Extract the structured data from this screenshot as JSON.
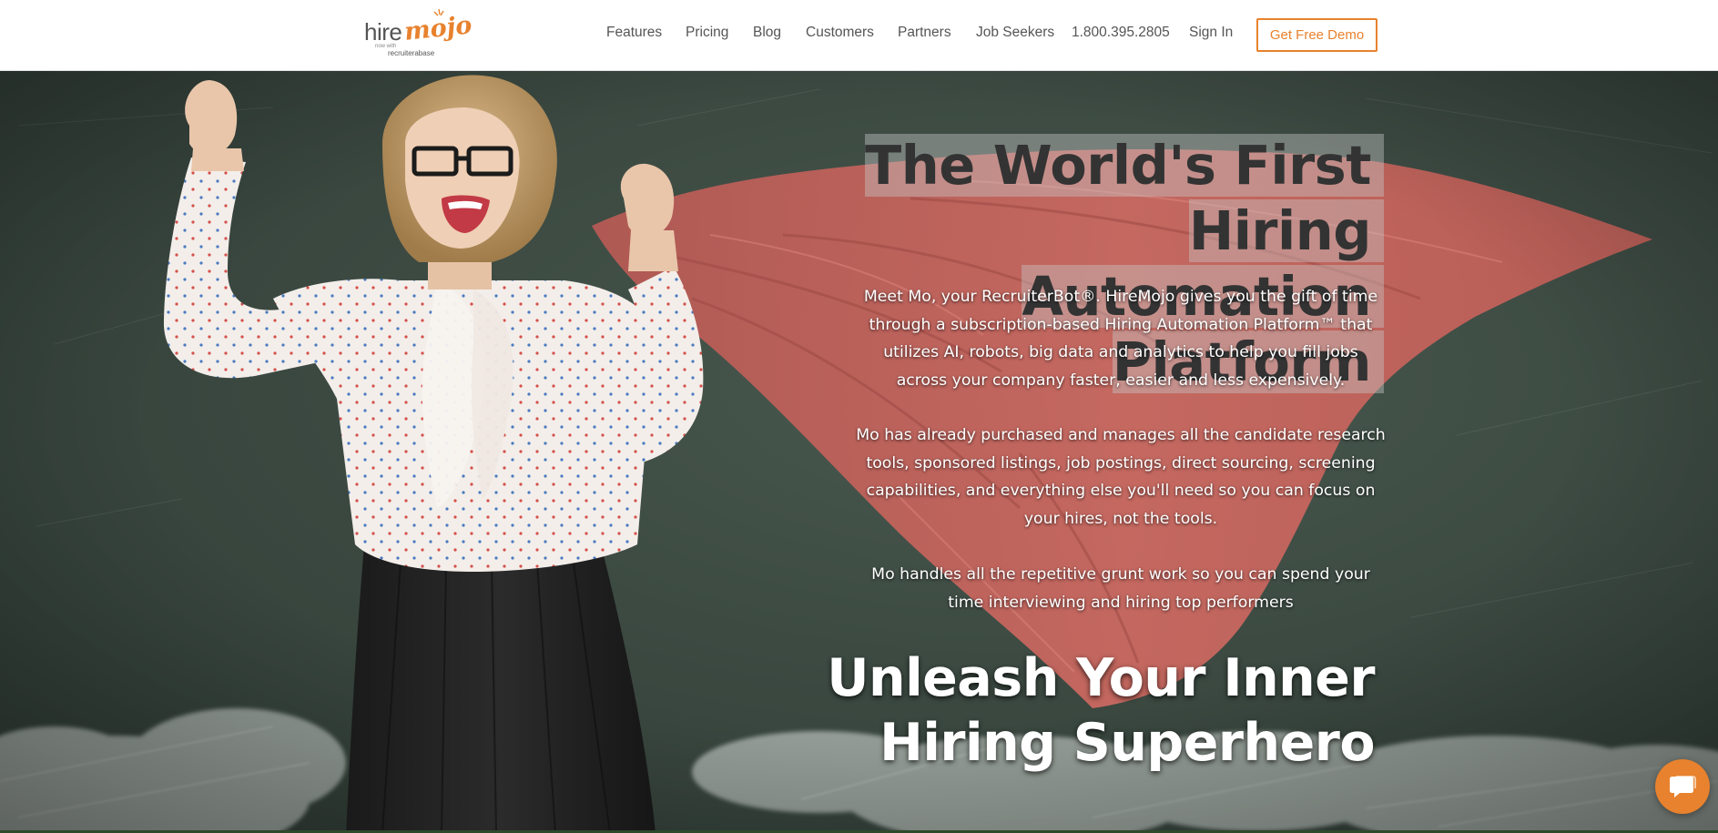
{
  "colors": {
    "accent": "#e8822e",
    "nav_text": "#555555",
    "chalkboard": "#3c4a42",
    "cape": "#c8625c",
    "headline": "#333333"
  },
  "logo": {
    "word_hire": "hire",
    "word_mojo": "mojo",
    "by_text": "now with",
    "sub_text": "recruiterabase"
  },
  "nav": {
    "items": [
      {
        "label": "Features"
      },
      {
        "label": "Pricing"
      },
      {
        "label": "Blog"
      },
      {
        "label": "Customers"
      },
      {
        "label": "Partners"
      },
      {
        "label": "Job Seekers"
      },
      {
        "label": "1.800.395.2805"
      },
      {
        "label": "Sign In"
      }
    ],
    "cta_label": "Get Free Demo"
  },
  "hero": {
    "headline_line1": "The World's First Hiring",
    "headline_line2": "Automation Platform",
    "paragraph1": "Meet Mo, your RecruiterBot®. HireMojo gives you the gift of time through a subscription-based Hiring Automation Platform™ that utilizes AI, robots, big data and analytics to help you fill jobs across your company faster, easier and less expensively.",
    "paragraph2": "Mo has already purchased and manages all the candidate research tools, sponsored listings, job postings, direct sourcing, screening capabilities, and everything else you'll need so you can focus on your hires, not the tools.",
    "paragraph3": "Mo handles all the repetitive grunt work so you can spend your time interviewing and hiring top performers",
    "tagline_line1": "Unleash Your Inner",
    "tagline_line2": "Hiring Superhero"
  },
  "chat": {
    "icon": "chat-bubble-icon"
  }
}
